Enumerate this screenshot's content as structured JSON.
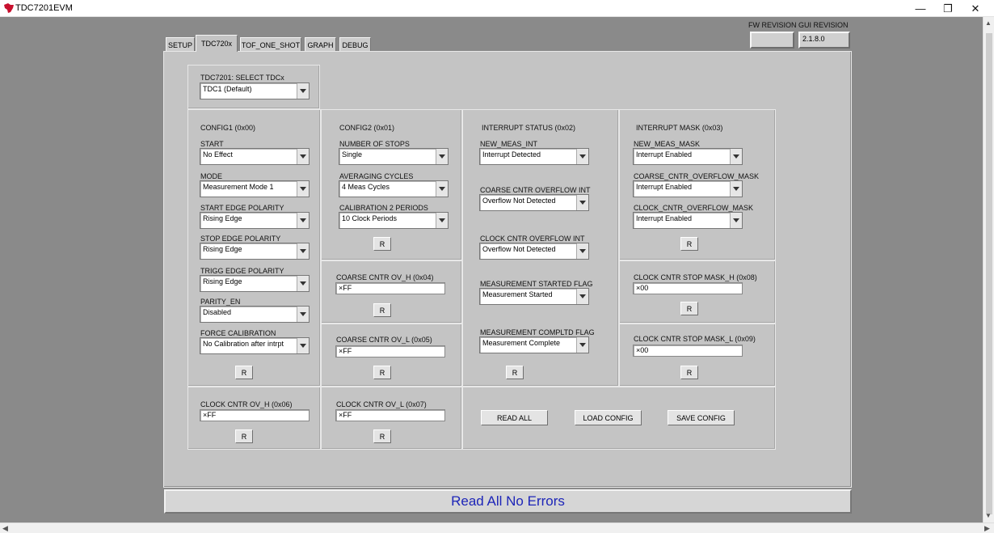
{
  "window": {
    "title": "TDC7201EVM",
    "minimize": "—",
    "restore": "❐",
    "close": "✕"
  },
  "revision": {
    "fw_label": "FW REVISION",
    "fw_value": "",
    "gui_label": "GUI REVISION",
    "gui_value": "2.1.8.0"
  },
  "tabs": [
    "SETUP",
    "TDC720x",
    "TOF_ONE_SHOT",
    "GRAPH",
    "DEBUG"
  ],
  "active_tab": "TDC720x",
  "select_tdc": {
    "label": "TDC7201: SELECT TDCx",
    "value": "TDC1 (Default)"
  },
  "config1": {
    "title": "CONFIG1 (0x00)",
    "fields": [
      {
        "label": "START",
        "value": "No Effect"
      },
      {
        "label": "MODE",
        "value": "Measurement Mode 1"
      },
      {
        "label": "START EDGE POLARITY",
        "value": "Rising Edge"
      },
      {
        "label": "STOP EDGE POLARITY",
        "value": "Rising Edge"
      },
      {
        "label": "TRIGG EDGE POLARITY",
        "value": "Rising Edge"
      },
      {
        "label": "PARITY_EN",
        "value": "Disabled"
      },
      {
        "label": "FORCE CALIBRATION",
        "value": "No Calibration after intrpt"
      }
    ]
  },
  "config2": {
    "title": "CONFIG2 (0x01)",
    "fields": [
      {
        "label": "NUMBER OF STOPS",
        "value": "Single"
      },
      {
        "label": "AVERAGING CYCLES",
        "value": "4 Meas Cycles"
      },
      {
        "label": "CALIBRATION 2 PERIODS",
        "value": "10 Clock Periods"
      }
    ]
  },
  "interrupt_status": {
    "title": "INTERRUPT STATUS (0x02)",
    "fields": [
      {
        "label": "NEW_MEAS_INT",
        "value": "Interrupt Detected"
      },
      {
        "label": "COARSE CNTR OVERFLOW INT",
        "value": "Overflow Not Detected"
      },
      {
        "label": "CLOCK CNTR OVERFLOW INT",
        "value": "Overflow Not Detected"
      },
      {
        "label": "MEASUREMENT STARTED FLAG",
        "value": "Measurement Started"
      },
      {
        "label": "MEASUREMENT COMPLTD FLAG",
        "value": "Measurement Complete"
      }
    ]
  },
  "interrupt_mask": {
    "title": "INTERRUPT MASK (0x03)",
    "fields": [
      {
        "label": "NEW_MEAS_MASK",
        "value": "Interrupt Enabled"
      },
      {
        "label": "COARSE_CNTR_OVERFLOW_MASK",
        "value": "Interrupt Enabled"
      },
      {
        "label": "CLOCK_CNTR_OVERFLOW_MASK",
        "value": "Interrupt Enabled"
      }
    ]
  },
  "registers": {
    "coarse_ov_h": {
      "label": "COARSE CNTR OV_H (0x04)",
      "value": "×FF"
    },
    "coarse_ov_l": {
      "label": "COARSE CNTR OV_L (0x05)",
      "value": "×FF"
    },
    "clock_ov_h": {
      "label": "CLOCK CNTR OV_H (0x06)",
      "value": "×FF"
    },
    "clock_ov_l": {
      "label": "CLOCK CNTR OV_L (0x07)",
      "value": "×FF"
    },
    "clock_stop_mask_h": {
      "label": "CLOCK CNTR STOP MASK_H (0x08)",
      "value": "×00"
    },
    "clock_stop_mask_l": {
      "label": "CLOCK CNTR STOP MASK_L (0x09)",
      "value": "×00"
    }
  },
  "read_button_label": "R",
  "actions": {
    "read_all": "READ ALL",
    "load_config": "LOAD CONFIG",
    "save_config": "SAVE CONFIG"
  },
  "status": {
    "text": "Read All No Errors",
    "color": "#1d25b8"
  },
  "colors": {
    "panel": "#c4c4c4",
    "background": "#8a8a8a"
  }
}
